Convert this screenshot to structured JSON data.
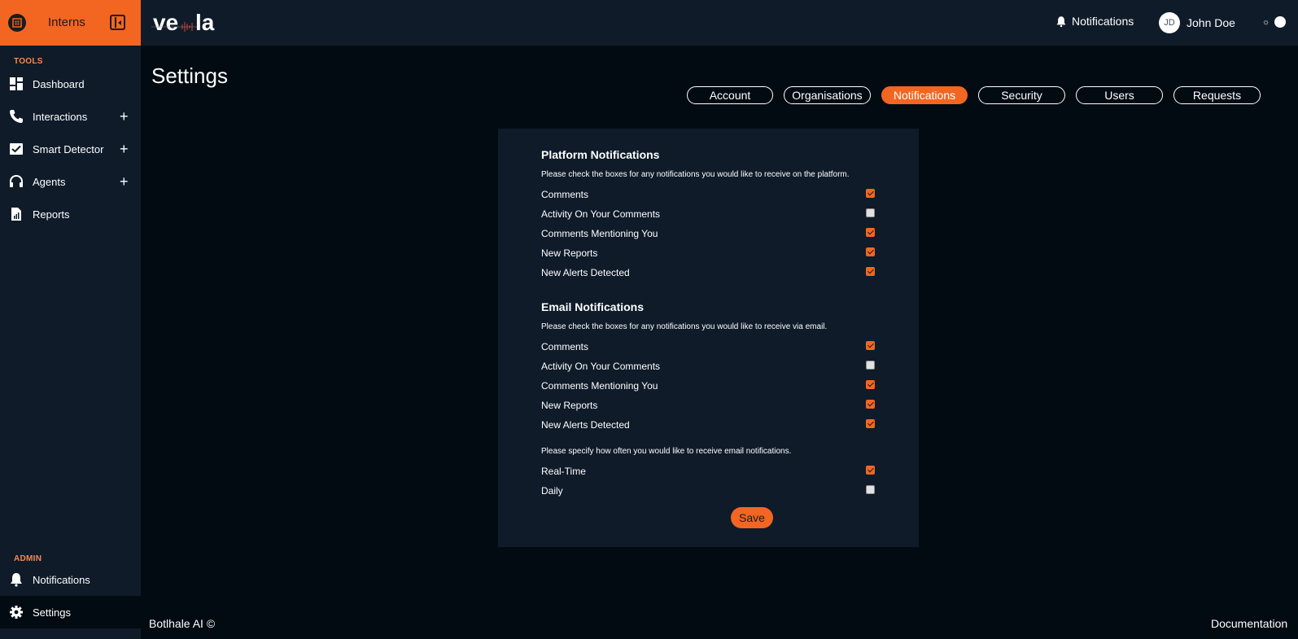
{
  "brand": {
    "name": "Interns",
    "logo_text": "vela"
  },
  "sidebar": {
    "tools_label": "TOOLS",
    "items": [
      {
        "label": "Dashboard",
        "icon": "dashboard-icon"
      },
      {
        "label": "Interactions",
        "icon": "phone-icon",
        "expandable": true
      },
      {
        "label": "Smart Detector",
        "icon": "check-chart-icon",
        "expandable": true
      },
      {
        "label": "Agents",
        "icon": "headset-icon",
        "expandable": true
      },
      {
        "label": "Reports",
        "icon": "report-icon"
      }
    ],
    "admin_label": "ADMIN",
    "admin_items": [
      {
        "label": "Notifications",
        "icon": "bell-icon"
      },
      {
        "label": "Settings",
        "icon": "gear-icon",
        "active": true
      }
    ]
  },
  "header": {
    "notifications_label": "Notifications",
    "user_initials": "JD",
    "user_name": "John Doe"
  },
  "page": {
    "title": "Settings",
    "tabs": [
      "Account",
      "Organisations",
      "Notifications",
      "Security",
      "Users",
      "Requests"
    ],
    "active_tab": "Notifications"
  },
  "platform": {
    "title": "Platform Notifications",
    "description": "Please check the boxes for any notifications you would like to receive on the platform.",
    "options": [
      {
        "label": "Comments",
        "checked": true
      },
      {
        "label": "Activity On Your Comments",
        "checked": false
      },
      {
        "label": "Comments Mentioning You",
        "checked": true
      },
      {
        "label": "New Reports",
        "checked": true
      },
      {
        "label": "New Alerts Detected",
        "checked": true
      }
    ]
  },
  "email": {
    "title": "Email Notifications",
    "description": "Please check the boxes for any notifications you would like to receive via email.",
    "options": [
      {
        "label": "Comments",
        "checked": true
      },
      {
        "label": "Activity On Your Comments",
        "checked": false
      },
      {
        "label": "Comments Mentioning You",
        "checked": true
      },
      {
        "label": "New Reports",
        "checked": true
      },
      {
        "label": "New Alerts Detected",
        "checked": true
      }
    ],
    "frequency_description": "Please specify how often you would like to receive email notifications.",
    "frequency": [
      {
        "label": "Real-Time",
        "checked": true
      },
      {
        "label": "Daily",
        "checked": false
      }
    ]
  },
  "actions": {
    "save_label": "Save"
  },
  "footer": {
    "copyright": "Botlhale AI ©",
    "documentation": "Documentation"
  },
  "colors": {
    "accent": "#f26622",
    "sidebar_bg": "#0f1b29",
    "page_bg": "#020b12",
    "section_label": "#f28a5a"
  }
}
